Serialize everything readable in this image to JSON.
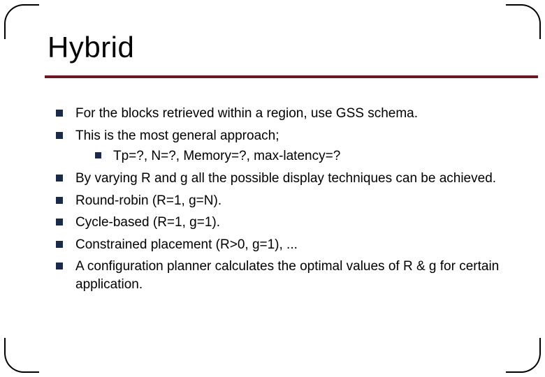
{
  "title": "Hybrid",
  "bullets": [
    {
      "text": "For the blocks retrieved within a region, use GSS schema."
    },
    {
      "text": "This is the most general approach;",
      "sub": [
        {
          "text": "Tp=?, N=?, Memory=?, max-latency=?"
        }
      ]
    },
    {
      "text": "By varying R and g all the possible display techniques can be achieved."
    },
    {
      "text": "Round-robin (R=1, g=N)."
    },
    {
      "text": "Cycle-based (R=1, g=1)."
    },
    {
      "text": "Constrained placement  (R>0, g=1), ..."
    },
    {
      "text": "A configuration planner calculates the optimal values of R & g for certain application."
    }
  ]
}
